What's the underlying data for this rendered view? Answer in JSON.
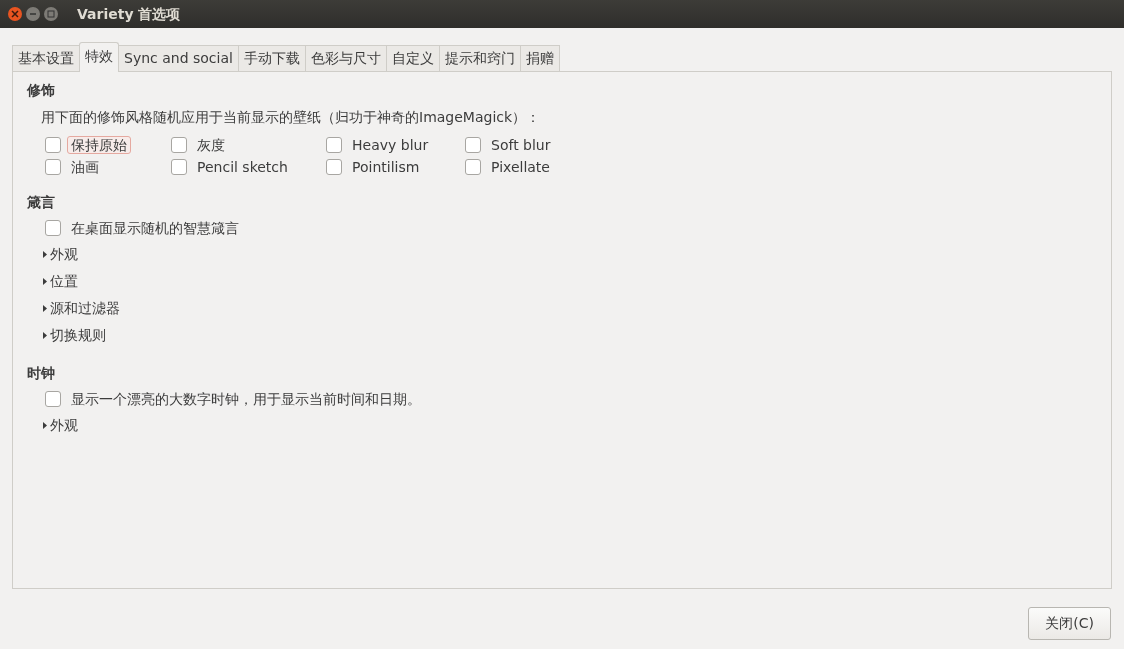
{
  "window": {
    "title": "Variety 首选项"
  },
  "tabs": [
    {
      "label": "基本设置",
      "selected": false
    },
    {
      "label": "特效",
      "selected": true
    },
    {
      "label": "Sync and social",
      "selected": false
    },
    {
      "label": "手动下载",
      "selected": false
    },
    {
      "label": "色彩与尺寸",
      "selected": false
    },
    {
      "label": "自定义",
      "selected": false
    },
    {
      "label": "提示和窍门",
      "selected": false
    },
    {
      "label": "捐赠",
      "selected": false
    }
  ],
  "filters": {
    "heading": "修饰",
    "description": "用下面的修饰风格随机应用于当前显示的壁纸（归功于神奇的ImageMagick）：",
    "options": [
      {
        "label": "保持原始",
        "checked": false,
        "focused": true
      },
      {
        "label": "灰度",
        "checked": false,
        "focused": false
      },
      {
        "label": "Heavy blur",
        "checked": false,
        "focused": false
      },
      {
        "label": "Soft blur",
        "checked": false,
        "focused": false
      },
      {
        "label": "油画",
        "checked": false,
        "focused": false
      },
      {
        "label": "Pencil sketch",
        "checked": false,
        "focused": false
      },
      {
        "label": "Pointilism",
        "checked": false,
        "focused": false
      },
      {
        "label": "Pixellate",
        "checked": false,
        "focused": false
      }
    ]
  },
  "sections": [
    {
      "heading": "箴言",
      "checkbox": {
        "label": "在桌面显示随机的智慧箴言",
        "checked": false
      },
      "expanders": [
        {
          "label": "外观",
          "expanded": false
        },
        {
          "label": "位置",
          "expanded": false
        },
        {
          "label": "源和过滤器",
          "expanded": false
        },
        {
          "label": "切换规则",
          "expanded": false
        }
      ]
    },
    {
      "heading": "时钟",
      "checkbox": {
        "label": "显示一个漂亮的大数字时钟，用于显示当前时间和日期。",
        "checked": false
      },
      "expanders": [
        {
          "label": "外观",
          "expanded": false
        }
      ]
    }
  ],
  "buttons": [
    {
      "label": "关闭(C)"
    }
  ]
}
